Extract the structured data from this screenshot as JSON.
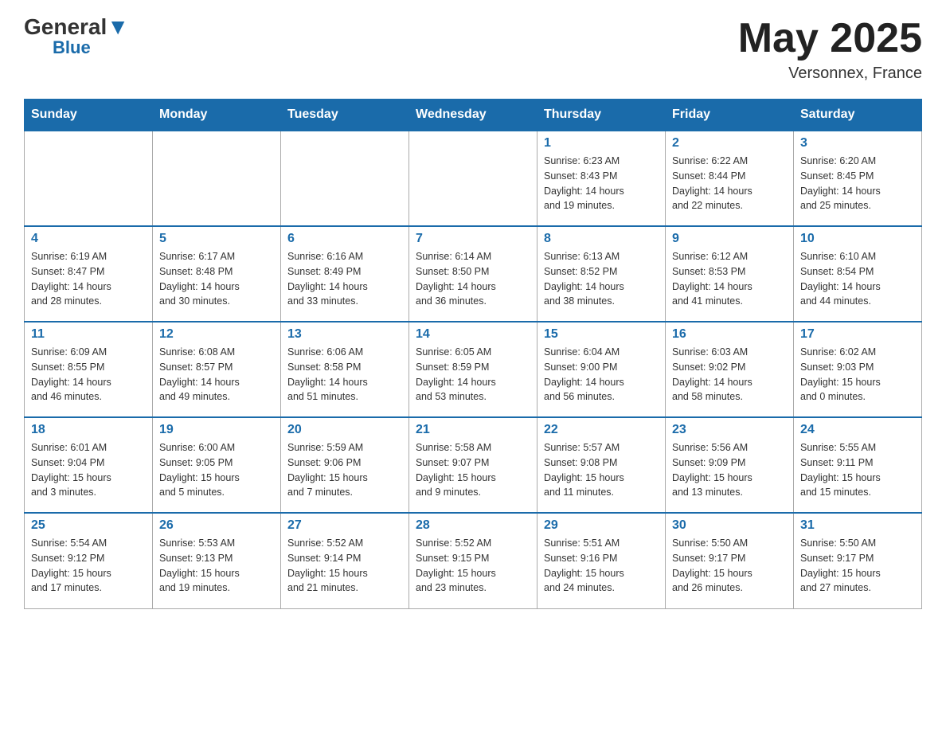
{
  "header": {
    "logo_general": "General",
    "logo_arrow": "▼",
    "logo_blue": "Blue",
    "month_title": "May 2025",
    "location": "Versonnex, France"
  },
  "weekdays": [
    "Sunday",
    "Monday",
    "Tuesday",
    "Wednesday",
    "Thursday",
    "Friday",
    "Saturday"
  ],
  "weeks": [
    [
      {
        "day": "",
        "info": ""
      },
      {
        "day": "",
        "info": ""
      },
      {
        "day": "",
        "info": ""
      },
      {
        "day": "",
        "info": ""
      },
      {
        "day": "1",
        "info": "Sunrise: 6:23 AM\nSunset: 8:43 PM\nDaylight: 14 hours\nand 19 minutes."
      },
      {
        "day": "2",
        "info": "Sunrise: 6:22 AM\nSunset: 8:44 PM\nDaylight: 14 hours\nand 22 minutes."
      },
      {
        "day": "3",
        "info": "Sunrise: 6:20 AM\nSunset: 8:45 PM\nDaylight: 14 hours\nand 25 minutes."
      }
    ],
    [
      {
        "day": "4",
        "info": "Sunrise: 6:19 AM\nSunset: 8:47 PM\nDaylight: 14 hours\nand 28 minutes."
      },
      {
        "day": "5",
        "info": "Sunrise: 6:17 AM\nSunset: 8:48 PM\nDaylight: 14 hours\nand 30 minutes."
      },
      {
        "day": "6",
        "info": "Sunrise: 6:16 AM\nSunset: 8:49 PM\nDaylight: 14 hours\nand 33 minutes."
      },
      {
        "day": "7",
        "info": "Sunrise: 6:14 AM\nSunset: 8:50 PM\nDaylight: 14 hours\nand 36 minutes."
      },
      {
        "day": "8",
        "info": "Sunrise: 6:13 AM\nSunset: 8:52 PM\nDaylight: 14 hours\nand 38 minutes."
      },
      {
        "day": "9",
        "info": "Sunrise: 6:12 AM\nSunset: 8:53 PM\nDaylight: 14 hours\nand 41 minutes."
      },
      {
        "day": "10",
        "info": "Sunrise: 6:10 AM\nSunset: 8:54 PM\nDaylight: 14 hours\nand 44 minutes."
      }
    ],
    [
      {
        "day": "11",
        "info": "Sunrise: 6:09 AM\nSunset: 8:55 PM\nDaylight: 14 hours\nand 46 minutes."
      },
      {
        "day": "12",
        "info": "Sunrise: 6:08 AM\nSunset: 8:57 PM\nDaylight: 14 hours\nand 49 minutes."
      },
      {
        "day": "13",
        "info": "Sunrise: 6:06 AM\nSunset: 8:58 PM\nDaylight: 14 hours\nand 51 minutes."
      },
      {
        "day": "14",
        "info": "Sunrise: 6:05 AM\nSunset: 8:59 PM\nDaylight: 14 hours\nand 53 minutes."
      },
      {
        "day": "15",
        "info": "Sunrise: 6:04 AM\nSunset: 9:00 PM\nDaylight: 14 hours\nand 56 minutes."
      },
      {
        "day": "16",
        "info": "Sunrise: 6:03 AM\nSunset: 9:02 PM\nDaylight: 14 hours\nand 58 minutes."
      },
      {
        "day": "17",
        "info": "Sunrise: 6:02 AM\nSunset: 9:03 PM\nDaylight: 15 hours\nand 0 minutes."
      }
    ],
    [
      {
        "day": "18",
        "info": "Sunrise: 6:01 AM\nSunset: 9:04 PM\nDaylight: 15 hours\nand 3 minutes."
      },
      {
        "day": "19",
        "info": "Sunrise: 6:00 AM\nSunset: 9:05 PM\nDaylight: 15 hours\nand 5 minutes."
      },
      {
        "day": "20",
        "info": "Sunrise: 5:59 AM\nSunset: 9:06 PM\nDaylight: 15 hours\nand 7 minutes."
      },
      {
        "day": "21",
        "info": "Sunrise: 5:58 AM\nSunset: 9:07 PM\nDaylight: 15 hours\nand 9 minutes."
      },
      {
        "day": "22",
        "info": "Sunrise: 5:57 AM\nSunset: 9:08 PM\nDaylight: 15 hours\nand 11 minutes."
      },
      {
        "day": "23",
        "info": "Sunrise: 5:56 AM\nSunset: 9:09 PM\nDaylight: 15 hours\nand 13 minutes."
      },
      {
        "day": "24",
        "info": "Sunrise: 5:55 AM\nSunset: 9:11 PM\nDaylight: 15 hours\nand 15 minutes."
      }
    ],
    [
      {
        "day": "25",
        "info": "Sunrise: 5:54 AM\nSunset: 9:12 PM\nDaylight: 15 hours\nand 17 minutes."
      },
      {
        "day": "26",
        "info": "Sunrise: 5:53 AM\nSunset: 9:13 PM\nDaylight: 15 hours\nand 19 minutes."
      },
      {
        "day": "27",
        "info": "Sunrise: 5:52 AM\nSunset: 9:14 PM\nDaylight: 15 hours\nand 21 minutes."
      },
      {
        "day": "28",
        "info": "Sunrise: 5:52 AM\nSunset: 9:15 PM\nDaylight: 15 hours\nand 23 minutes."
      },
      {
        "day": "29",
        "info": "Sunrise: 5:51 AM\nSunset: 9:16 PM\nDaylight: 15 hours\nand 24 minutes."
      },
      {
        "day": "30",
        "info": "Sunrise: 5:50 AM\nSunset: 9:17 PM\nDaylight: 15 hours\nand 26 minutes."
      },
      {
        "day": "31",
        "info": "Sunrise: 5:50 AM\nSunset: 9:17 PM\nDaylight: 15 hours\nand 27 minutes."
      }
    ]
  ]
}
